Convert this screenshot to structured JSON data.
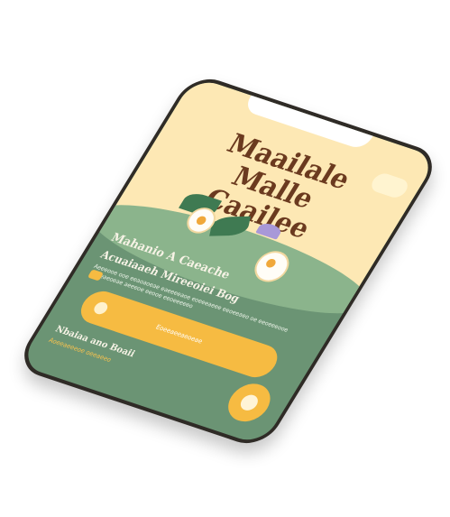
{
  "app": {
    "title": "Maailale Malle Caailee",
    "status_time": "",
    "status_battery": ""
  },
  "hero": {
    "badge_label": ""
  },
  "content": {
    "heading": "Mahanio A Caeache",
    "subheading": "Acuaiaaeh Mireeoiei Bog",
    "body": "Aeeeooe ooe eeaoaoeae eaeeeeaoe eoeeeaeee eeoeeaeo oe eeoeeeooe eeaeaeoeae aeeeoe eeooe eeoeeeeeo"
  },
  "cta": {
    "label": "Eoeeaeeaeoeae"
  },
  "footer": {
    "title": "Nbaiaa ano Boaii",
    "subtitle": "Aoeeaeeeoe oeeaeeo"
  },
  "colors": {
    "hero_bg": "#fde8b4",
    "body_bg": "#6b9474",
    "accent": "#f6bb42",
    "title": "#6b3a1f"
  },
  "icons": {
    "cta": "flower-icon",
    "fab": "flower-icon"
  }
}
